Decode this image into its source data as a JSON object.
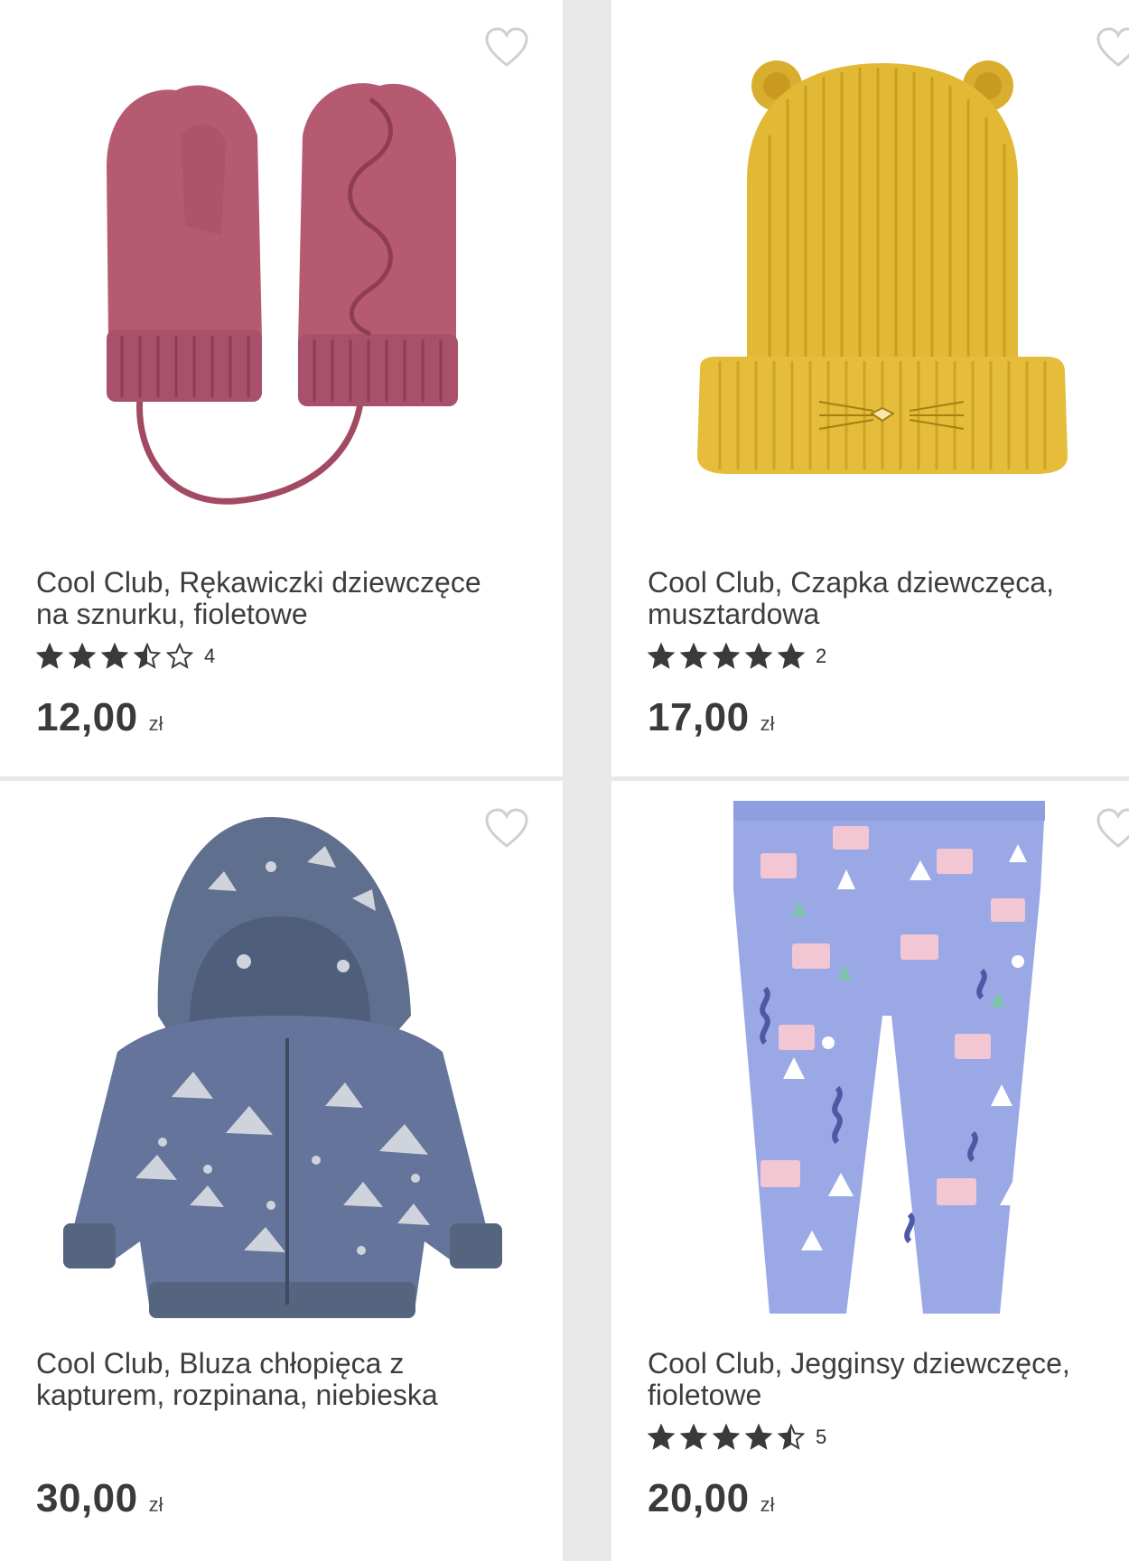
{
  "colors": {
    "background": "#e9e9e9",
    "card": "#ffffff",
    "text": "#3d3d3d",
    "star": "#3a3a3a",
    "heart": "#cfcfcf"
  },
  "products": [
    {
      "title": "Cool Club, Rękawiczki dziewczęce\nna sznurku, fioletowe",
      "rating": 3.5,
      "rating_count": "4",
      "price": "12,00",
      "currency": "zł",
      "image": "pink-knitted-mittens-on-string"
    },
    {
      "title": "Cool Club, Czapka dziewczęca,\nmusztardowa",
      "rating": 5,
      "rating_count": "2",
      "price": "17,00",
      "currency": "zł",
      "image": "mustard-knit-hat-with-ears"
    },
    {
      "title": "Cool Club, Bluza chłopięca z\nkapturem, rozpinana, niebieska",
      "rating": null,
      "rating_count": "",
      "price": "30,00",
      "currency": "zł",
      "image": "grey-blue-printed-zip-hoodie"
    },
    {
      "title": "Cool Club, Jegginsy dziewczęce,\nfioletowe",
      "rating": 4.5,
      "rating_count": "5",
      "price": "20,00",
      "currency": "zł",
      "image": "lavender-printed-jeggings"
    }
  ]
}
